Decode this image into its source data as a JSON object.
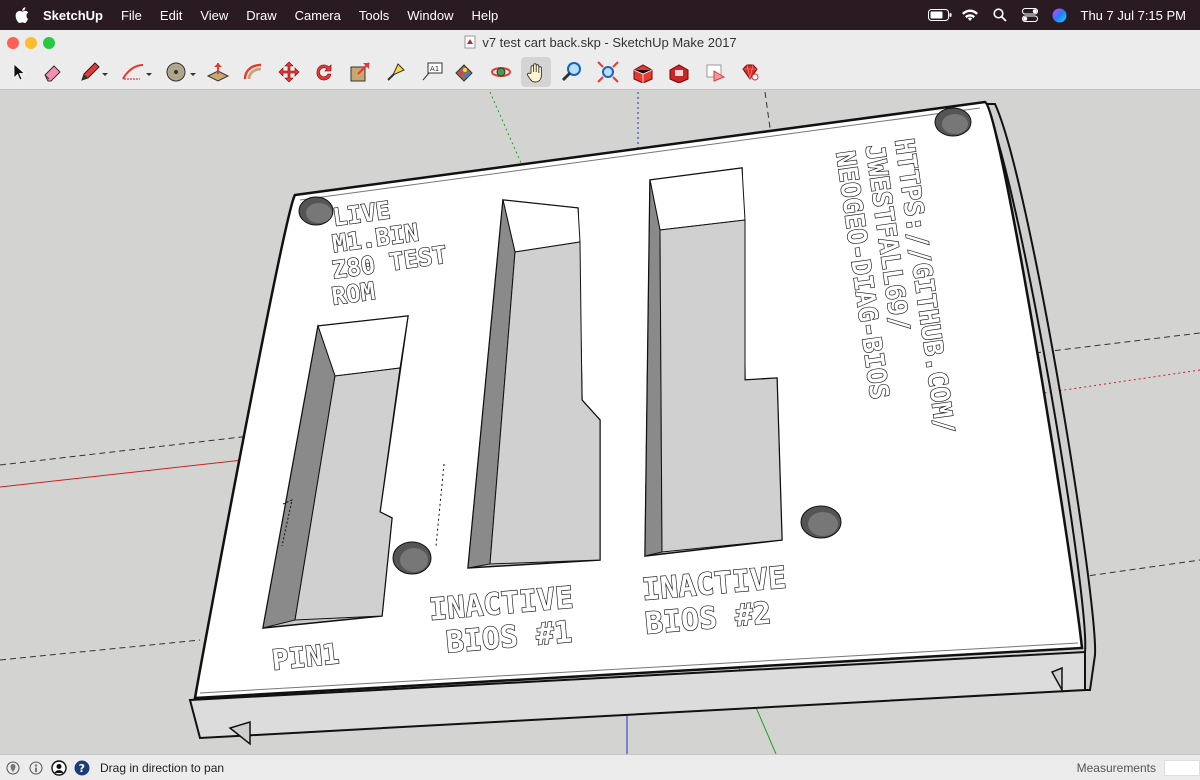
{
  "menubar": {
    "app_name": "SketchUp",
    "items": [
      "File",
      "Edit",
      "View",
      "Draw",
      "Camera",
      "Tools",
      "Window",
      "Help"
    ],
    "clock": "Thu 7 Jul  7:15 PM"
  },
  "window": {
    "title": "v7 test cart back.skp - SketchUp Make 2017"
  },
  "toolbar": {
    "tools": [
      "select",
      "eraser",
      "pencil",
      "arc",
      "shapes",
      "push-pull",
      "follow-me",
      "move",
      "rotate",
      "scale",
      "tape-measure",
      "text",
      "paint-bucket",
      "orbit",
      "pan",
      "zoom",
      "zoom-extents",
      "warehouse",
      "extension-warehouse",
      "send-to-layout",
      "ruby"
    ],
    "active_tool": "pan"
  },
  "model": {
    "labels": {
      "live_line1": "LIVE",
      "live_line2": "M1.BIN",
      "live_line3": "Z80 TEST",
      "live_line4": "ROM",
      "pin1": "PIN1",
      "inactive1_line1": "INACTIVE",
      "inactive1_line2": "BIOS #1",
      "inactive2_line1": "INACTIVE",
      "inactive2_line2": "BIOS #2",
      "url_line1": "HTTPS://GITHUB.COM/",
      "url_line2": "JWESTFALL69/",
      "url_line3": "NEOGEO-DIAG-BIOS"
    }
  },
  "statusbar": {
    "hint": "Drag in direction to pan",
    "measurements_label": "Measurements"
  },
  "colors": {
    "menubar_bg": "#2a1a22",
    "viewport_bg": "#d3d3d1",
    "axis_red": "#d02020",
    "axis_green": "#20a020",
    "axis_blue": "#2030c0"
  }
}
